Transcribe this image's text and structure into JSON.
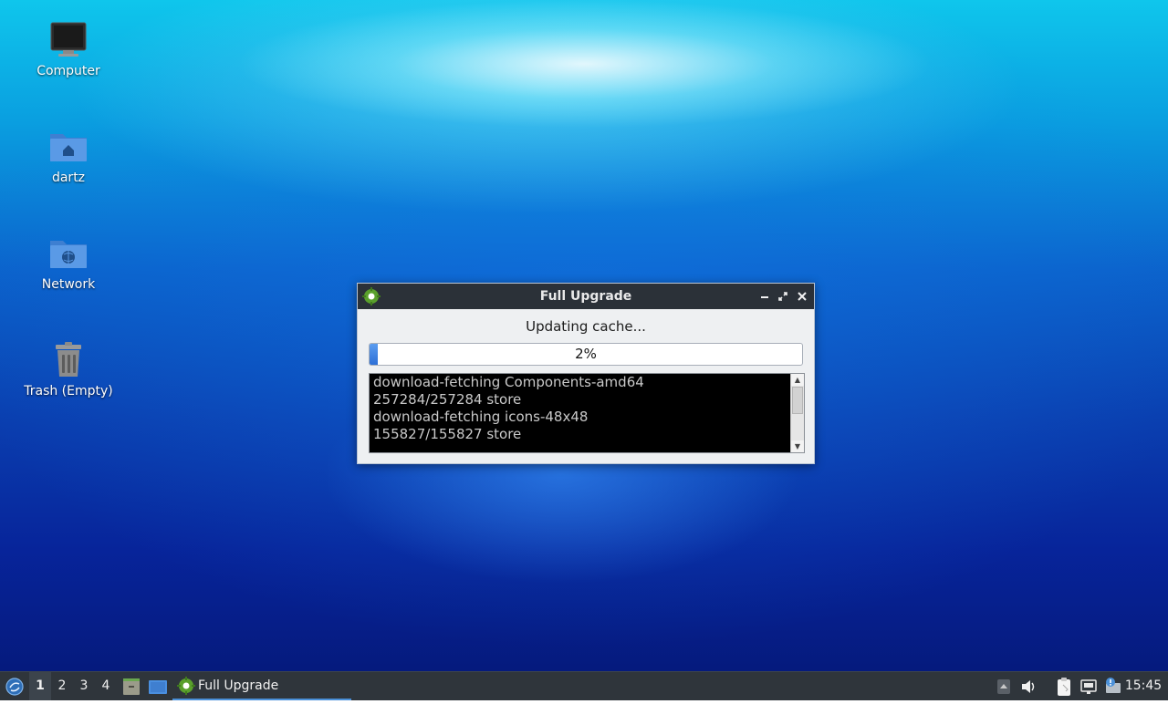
{
  "desktop": {
    "icons": [
      {
        "label": "Computer",
        "icon": "computer-icon"
      },
      {
        "label": "dartz",
        "icon": "home-folder-icon"
      },
      {
        "label": "Network",
        "icon": "network-folder-icon"
      },
      {
        "label": "Trash (Empty)",
        "icon": "trash-icon"
      }
    ]
  },
  "dialog": {
    "title": "Full Upgrade",
    "status": "Updating cache...",
    "progress": {
      "value": 2,
      "label": "2%"
    },
    "log_lines": [
      "download-fetching Components-amd64",
      "257284/257284 store",
      "download-fetching icons-48x48",
      "155827/155827 store"
    ]
  },
  "taskbar": {
    "workspaces": [
      "1",
      "2",
      "3",
      "4"
    ],
    "active_workspace": "1",
    "tasks": [
      {
        "label": "Full Upgrade",
        "icon": "gear-icon"
      }
    ],
    "clock": "15:45"
  },
  "colors": {
    "accent": "#4a90d9",
    "titlebar": "#2b3138",
    "taskbar": "#2f353b"
  }
}
